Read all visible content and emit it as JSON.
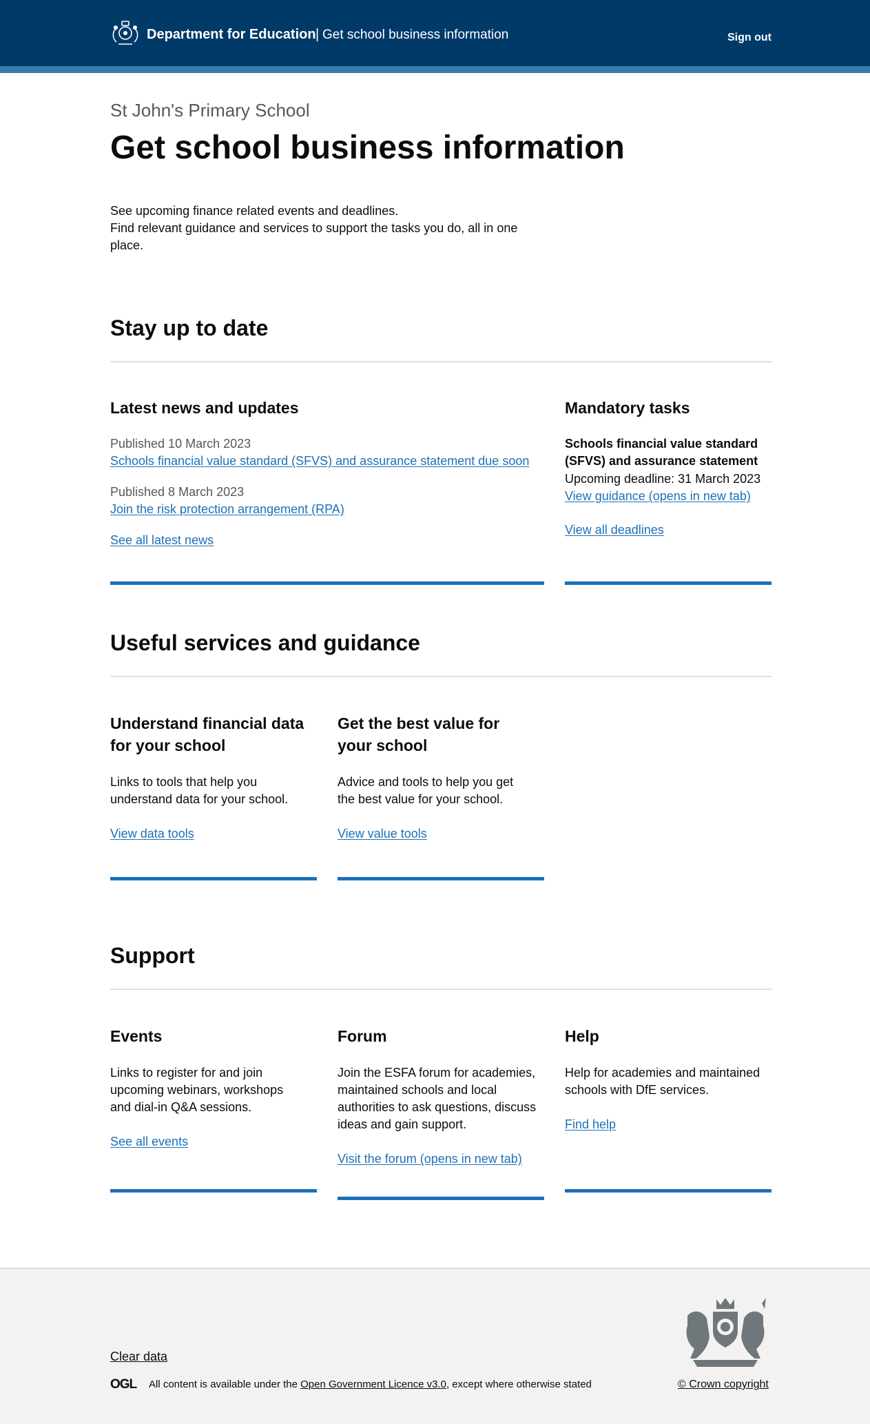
{
  "header": {
    "department": "Department for Education",
    "separator": "|",
    "service": "Get school business information",
    "sign_out": "Sign out",
    "background": "#003a69",
    "stripe": "#347ca9"
  },
  "page": {
    "caption": "St John's Primary School",
    "title": "Get school business information",
    "intro_line1": "See upcoming finance related events and deadlines.",
    "intro_line2": "Find relevant guidance and services to support the tasks you do, all in one",
    "intro_line3": "place."
  },
  "stay_up_to_date": {
    "heading": "Stay up to date",
    "news": {
      "heading": "Latest news and updates",
      "items": [
        {
          "published": "Published 10 March 2023",
          "link": "Schools financial value standard (SFVS) and assurance statement due soon"
        },
        {
          "published": "Published 8 March 2023",
          "link": "Join the risk protection arrangement (RPA)"
        }
      ],
      "see_all": "See all latest news"
    },
    "mandatory": {
      "heading": "Mandatory tasks",
      "task_title_line1": "Schools financial value standard",
      "task_title_line2": "(SFVS) and assurance statement",
      "deadline": "Upcoming deadline: 31 March 2023",
      "guidance_link": "View guidance (opens in new tab)",
      "all_deadlines": "View all deadlines"
    }
  },
  "useful_services": {
    "heading": "Useful services and guidance",
    "cards": [
      {
        "title_line1": "Understand financial data",
        "title_line2": "for your school",
        "desc_line1": "Links to tools that help you",
        "desc_line2": "understand data for your school.",
        "link": "View data tools"
      },
      {
        "title_line1": "Get the best value for",
        "title_line2": "your school",
        "desc_line1": "Advice and tools to help you get",
        "desc_line2": "the best value for your school.",
        "link": "View value tools"
      }
    ]
  },
  "support": {
    "heading": "Support",
    "events": {
      "title": "Events",
      "desc_line1": "Links to register for and join",
      "desc_line2": "upcoming webinars, workshops",
      "desc_line3": "and dial-in Q&A sessions.",
      "link": "See all events"
    },
    "forum": {
      "title": "Forum",
      "desc_line1": "Join the ESFA forum for academies,",
      "desc_line2": "maintained schools and local",
      "desc_line3": "authorities to ask questions, discuss",
      "desc_line4": "ideas and gain support.",
      "link": "Visit the forum (opens in new tab)"
    },
    "help": {
      "title": "Help",
      "desc_line1": "Help for academies and maintained",
      "desc_line2": "schools with DfE services.",
      "link": "Find help"
    }
  },
  "footer": {
    "clear_data": "Clear data",
    "ogl": "OGL",
    "licence_prefix": "All content is available under the ",
    "licence_link": "Open Government Licence v3.0",
    "licence_suffix": ", except where otherwise stated",
    "copyright": "© Crown copyright"
  },
  "colors": {
    "link": "#1d70b8",
    "card_bar": "#1d70b8",
    "rule": "#dde0e2",
    "footer_bg": "#f3f2f1",
    "secondary_text": "#505a5f"
  },
  "icons": {
    "header_crest": "dfe-crest-icon",
    "footer_arms": "royal-coat-of-arms-icon"
  }
}
